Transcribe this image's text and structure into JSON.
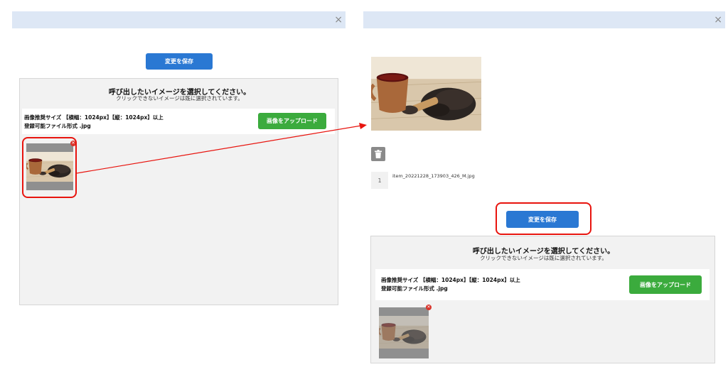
{
  "left": {
    "close_glyph": "×",
    "save_label": "変更を保存",
    "heading": "呼び出したいイメージを選択してください。",
    "subheading": "クリックできないイメージは既に選択されています。",
    "size_line": "画像推奨サイズ 【横幅：1024px】【縦：1024px】以上",
    "format_line": "登録可能ファイル形式 .jpg",
    "upload_label": "画像をアップロード",
    "badge_glyph": "✕"
  },
  "right": {
    "close_glyph": "×",
    "file_index": "1",
    "file_name": "item_20221228_173903_426_M.jpg",
    "save_label": "変更を保存",
    "heading": "呼び出したいイメージを選択してください。",
    "subheading": "クリックできないイメージは既に選択されています。",
    "size_line": "画像推奨サイズ 【横幅：1024px】【縦：1024px】以上",
    "format_line": "登録可能ファイル形式 .jpg",
    "upload_label": "画像をアップロード",
    "badge_glyph": "✕"
  },
  "colors": {
    "titlebar": "#dde7f5",
    "save_button": "#2a78d3",
    "upload_button": "#3bab3d",
    "highlight": "#e8140e",
    "badge": "#d9342b"
  },
  "icons": {
    "trash": "trash-icon",
    "close": "close-icon",
    "remove": "remove-badge-icon"
  }
}
